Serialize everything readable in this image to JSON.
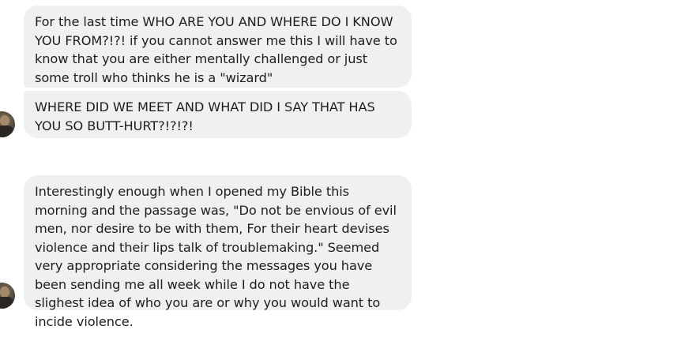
{
  "messages": [
    {
      "text": "For the last time WHO ARE YOU AND WHERE DO I KNOW YOU FROM?!?! if you cannot answer me this I will have to know that you are either mentally challenged or just some troll who thinks he is a \"wizard\""
    },
    {
      "text": "WHERE DID WE MEET AND WHAT DID I SAY THAT HAS YOU SO BUTT-HURT?!?!?!"
    },
    {
      "text": "Interestingly enough when I opened my Bible this morning and the passage was, \"Do not be envious of evil men, nor desire to be with them, For their heart devises violence and their lips talk of troublemaking.\" Seemed very appropriate considering the messages you have been sending me all week while I do not have the slighest idea of who you are or why you would want to incide violence."
    }
  ],
  "colors": {
    "bubble_background": "#f1f0f0",
    "text": "#1c1e21",
    "page_background": "#ffffff"
  },
  "icons": {
    "avatar": "user-avatar"
  }
}
